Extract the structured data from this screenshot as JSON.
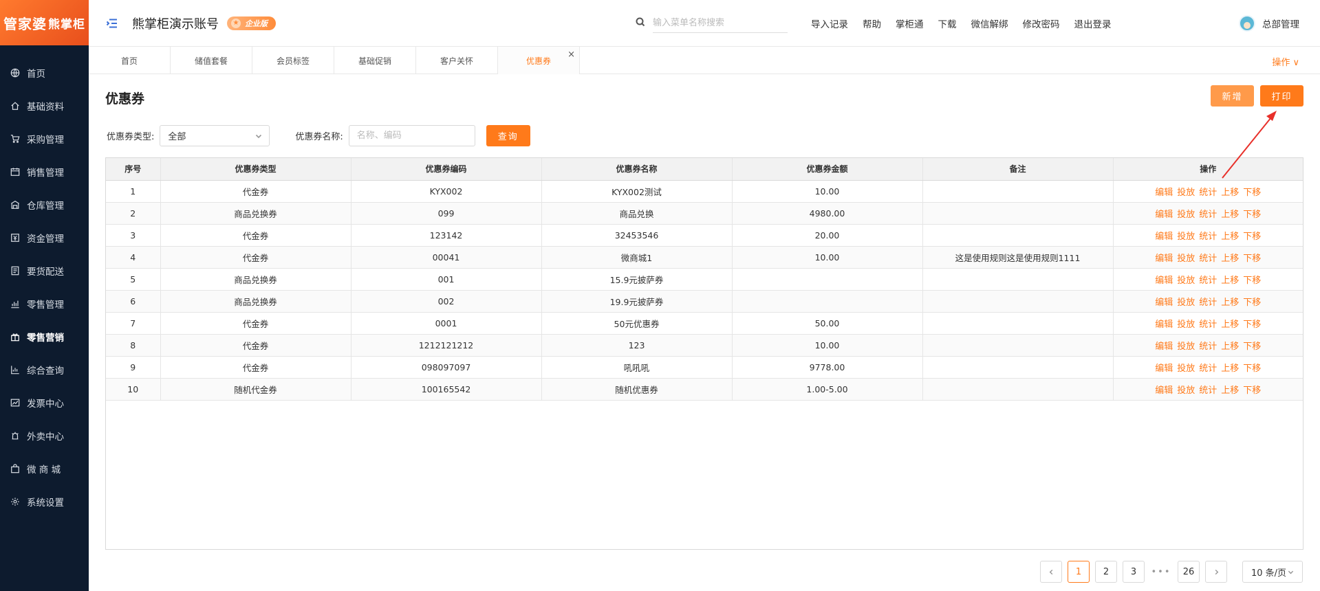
{
  "app": {
    "logo_main": "管家婆",
    "logo_sub": "熊掌柜",
    "account_name": "熊掌柜演示账号",
    "edition_badge": "企业版"
  },
  "sidebar": {
    "items": [
      {
        "label": "首页",
        "icon": "globe-icon"
      },
      {
        "label": "基础资料",
        "icon": "home-icon"
      },
      {
        "label": "采购管理",
        "icon": "cart-icon"
      },
      {
        "label": "销售管理",
        "icon": "calendar-icon"
      },
      {
        "label": "仓库管理",
        "icon": "warehouse-icon"
      },
      {
        "label": "资金管理",
        "icon": "money-icon"
      },
      {
        "label": "要货配送",
        "icon": "delivery-icon"
      },
      {
        "label": "零售管理",
        "icon": "chart-icon"
      },
      {
        "label": "零售营销",
        "icon": "gift-icon"
      },
      {
        "label": "综合查询",
        "icon": "bar-chart-icon"
      },
      {
        "label": "发票中心",
        "icon": "invoice-icon"
      },
      {
        "label": "外卖中心",
        "icon": "takeout-icon"
      },
      {
        "label": "微 商 城",
        "icon": "shop-icon"
      },
      {
        "label": "系统设置",
        "icon": "gear-icon"
      }
    ]
  },
  "header": {
    "search_placeholder": "输入菜单名称搜索",
    "links": [
      "导入记录",
      "帮助",
      "掌柜通",
      "下载",
      "微信解绑",
      "修改密码",
      "退出登录"
    ],
    "user_name": "总部管理"
  },
  "tabs": {
    "items": [
      "首页",
      "储值套餐",
      "会员标签",
      "基础促销",
      "客户关怀",
      "优惠券"
    ],
    "close_glyph": "×",
    "operations_label": "操作"
  },
  "page": {
    "title": "优惠券",
    "add_label": "新增",
    "print_label": "打印"
  },
  "filters": {
    "type_label": "优惠券类型:",
    "type_value": "全部",
    "name_label": "优惠券名称:",
    "name_placeholder": "名称、编码",
    "query_label": "查询"
  },
  "table": {
    "headers": [
      "序号",
      "优惠券类型",
      "优惠券编码",
      "优惠券名称",
      "优惠券金额",
      "备注",
      "操作"
    ],
    "row_actions": [
      "编辑",
      "投放",
      "统计",
      "上移",
      "下移"
    ],
    "rows": [
      [
        "1",
        "代金券",
        "KYX002",
        "KYX002测试",
        "10.00",
        ""
      ],
      [
        "2",
        "商品兑换券",
        "099",
        "商品兑换",
        "4980.00",
        ""
      ],
      [
        "3",
        "代金券",
        "123142",
        "32453546",
        "20.00",
        ""
      ],
      [
        "4",
        "代金券",
        "00041",
        "微商城1",
        "10.00",
        "这是使用规则这是使用规则1111"
      ],
      [
        "5",
        "商品兑换券",
        "001",
        "15.9元披萨券",
        "",
        ""
      ],
      [
        "6",
        "商品兑换券",
        "002",
        "19.9元披萨券",
        "",
        ""
      ],
      [
        "7",
        "代金券",
        "0001",
        "50元优惠券",
        "50.00",
        ""
      ],
      [
        "8",
        "代金券",
        "1212121212",
        "123",
        "10.00",
        ""
      ],
      [
        "9",
        "代金券",
        "098097097",
        "吼吼吼",
        "9778.00",
        ""
      ],
      [
        "10",
        "随机代金券",
        "100165542",
        "随机优惠券",
        "1.00-5.00",
        ""
      ]
    ]
  },
  "pagination": {
    "pages": [
      "1",
      "2",
      "3"
    ],
    "ellipsis": "•••",
    "last_page": "26",
    "current": "1",
    "page_size": "10 条/页"
  },
  "colors": {
    "accent": "#ff7a1a",
    "sidebar_bg": "#0d1b2e",
    "annotation_arrow": "#e8302a"
  }
}
